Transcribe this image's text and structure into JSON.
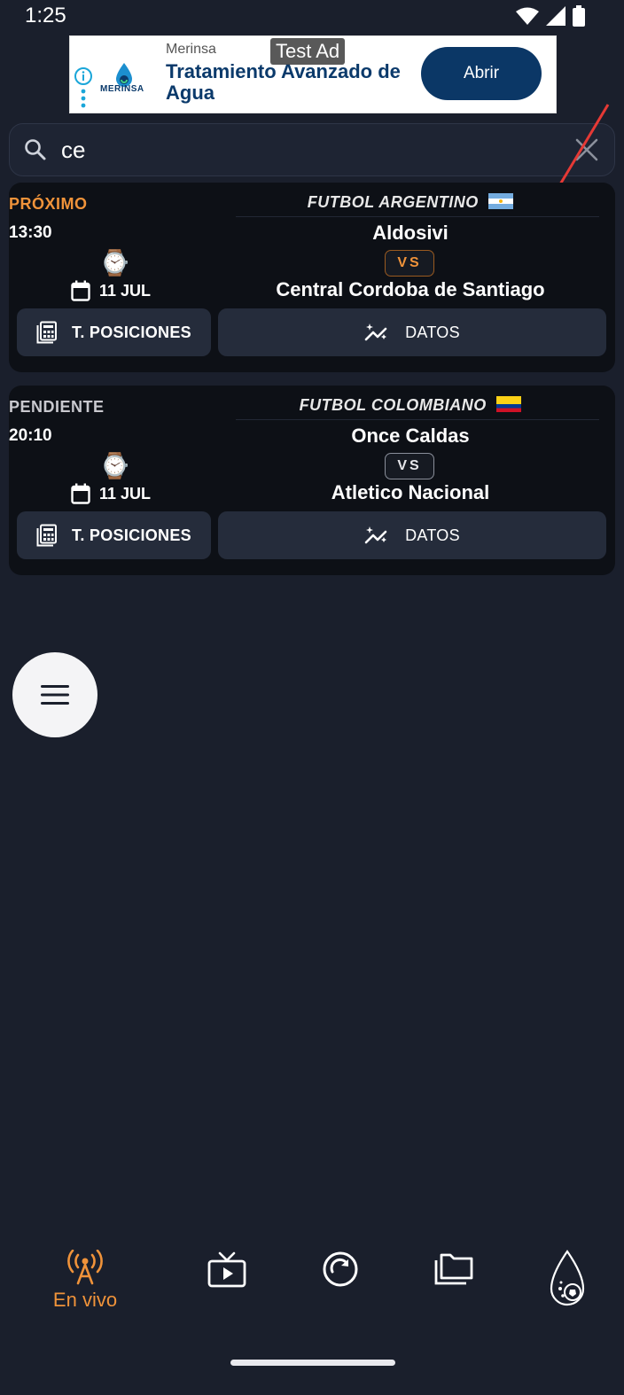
{
  "status": {
    "time": "1:25"
  },
  "ad": {
    "badge": "Test Ad",
    "brand": "Merinsa",
    "logo_text": "MERINSA",
    "headline": "Tratamiento Avanzado de Agua",
    "button": "Abrir"
  },
  "search": {
    "query": "ce"
  },
  "matches": [
    {
      "state": "PRÓXIMO",
      "state_color": "#f0933a",
      "time": "13:30",
      "date": "11 JUL",
      "league": "FUTBOL ARGENTINO",
      "flag": "argentina",
      "home": "Aldosivi",
      "vs": "VS",
      "vs_color": "#f0933a",
      "away": "Central Cordoba de Santiago",
      "btn_positions": "T. POSICIONES",
      "btn_data": "DATOS"
    },
    {
      "state": "PENDIENTE",
      "state_color": "#c9c9cf",
      "time": "20:10",
      "date": "11 JUL",
      "league": "FUTBOL COLOMBIANO",
      "flag": "colombia",
      "home": "Once Caldas",
      "vs": "VS",
      "vs_color": "#e6e6ea",
      "away": "Atletico Nacional",
      "btn_positions": "T. POSICIONES",
      "btn_data": "DATOS"
    }
  ],
  "nav": {
    "items": [
      {
        "icon": "broadcast-icon",
        "label": "En vivo",
        "active": true
      },
      {
        "icon": "tv-icon",
        "label": ""
      },
      {
        "icon": "refresh-circle-icon",
        "label": ""
      },
      {
        "icon": "folders-icon",
        "label": ""
      },
      {
        "icon": "drop-ball-icon",
        "label": ""
      }
    ],
    "active_color": "#f0933a"
  }
}
